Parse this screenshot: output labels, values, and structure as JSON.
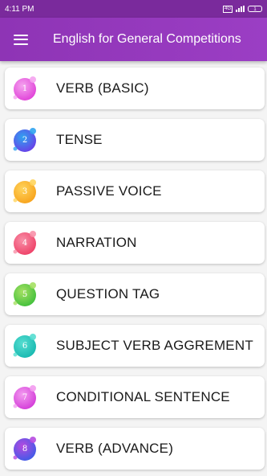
{
  "status_bar": {
    "time": "4:11 PM",
    "battery": "1",
    "network_badge": "4G"
  },
  "app_bar": {
    "menu_icon": "hamburger-menu-icon",
    "title": "English for General Competitions"
  },
  "topics": [
    {
      "number": "1",
      "label": "VERB (BASIC)",
      "color": "#e040d8",
      "accent": "#f5a3ef"
    },
    {
      "number": "2",
      "label": "TENSE",
      "color": "#6a3de8",
      "accent": "#2fa3f0"
    },
    {
      "number": "3",
      "label": "PASSIVE VOICE",
      "color": "#f7a21b",
      "accent": "#ffd45c"
    },
    {
      "number": "4",
      "label": "NARRATION",
      "color": "#ee3f66",
      "accent": "#f890a8"
    },
    {
      "number": "5",
      "label": "QUESTION TAG",
      "color": "#3fbf3a",
      "accent": "#a5e063"
    },
    {
      "number": "6",
      "label": "SUBJECT VERB AGGREMENT",
      "color": "#17b8b0",
      "accent": "#55ddd0"
    },
    {
      "number": "7",
      "label": "CONDITIONAL SENTENCE",
      "color": "#d33ad8",
      "accent": "#f39bf0"
    },
    {
      "number": "8",
      "label": "VERB (ADVANCE)",
      "color": "#3d5be8",
      "accent": "#b64ae0"
    }
  ]
}
